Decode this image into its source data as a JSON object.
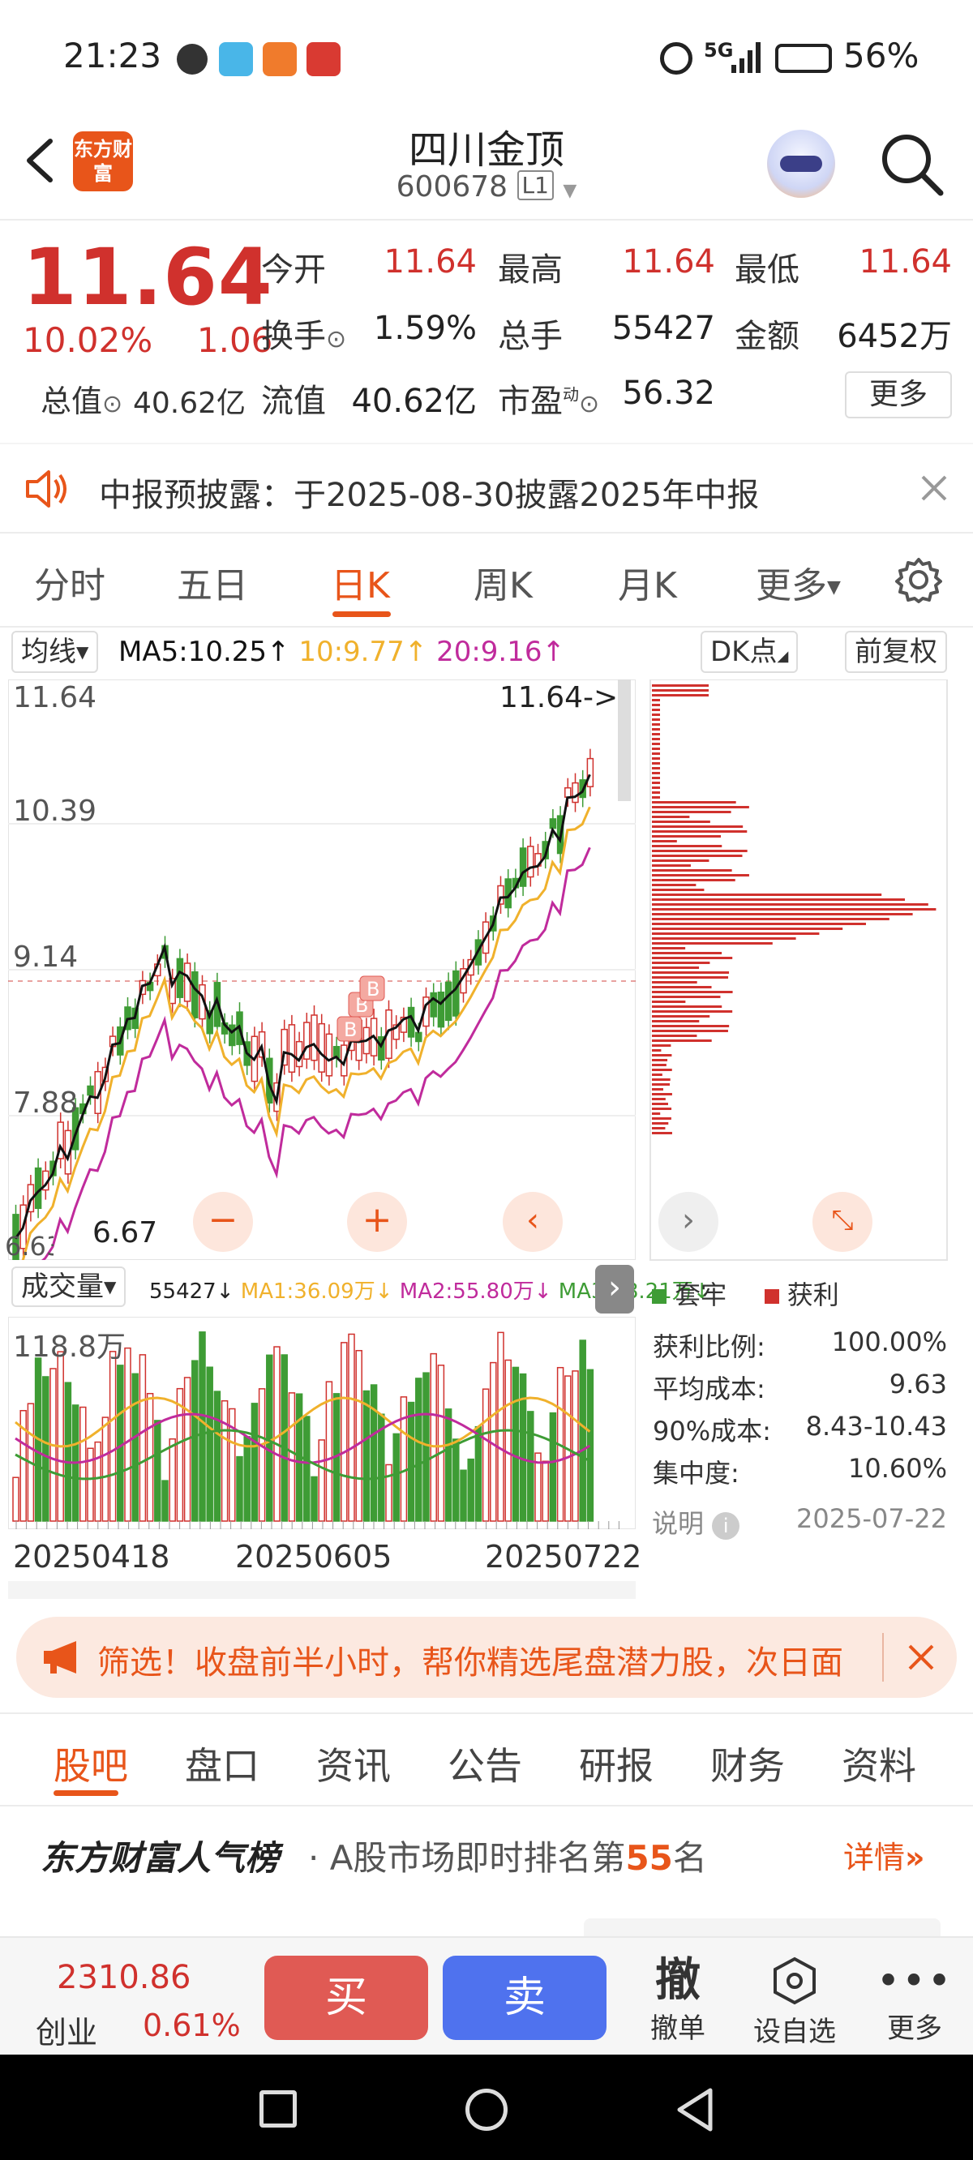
{
  "status_bar": {
    "time": "21:23",
    "network": "5G",
    "battery": "56%"
  },
  "header": {
    "title": "四川金顶",
    "code": "600678",
    "level_badge": "L1",
    "logo_text": "东方财富"
  },
  "quote": {
    "price": "11.64",
    "change_pct": "10.02%",
    "change_abs": "1.06",
    "labels": {
      "open": "今开",
      "high": "最高",
      "low": "最低",
      "turnover": "换手",
      "volume": "总手",
      "amount": "金额",
      "mktcap": "总值",
      "float_cap": "流值",
      "pe": "市盈",
      "pe_sup": "动"
    },
    "values": {
      "open": "11.64",
      "high": "11.64",
      "low": "11.64",
      "turnover": "1.59%",
      "volume": "55427",
      "amount": "6452万",
      "mktcap": "40.62亿",
      "float_cap": "40.62亿",
      "pe": "56.32"
    },
    "more_label": "更多"
  },
  "notice": {
    "text": "中报预披露：于2025-08-30披露2025年中报"
  },
  "period_tabs": [
    "分时",
    "五日",
    "日K",
    "周K",
    "月K",
    "更多"
  ],
  "indicator_row": {
    "ma_selector": "均线",
    "ma5": "MA5:10.25↑",
    "ma10": "10:9.77↑",
    "ma20": "20:9.16↑",
    "dk_button": "DK点",
    "adjust_button": "前复权"
  },
  "kline": {
    "price_labels": [
      "11.64",
      "10.39",
      "9.14",
      "7.88",
      "6.63"
    ],
    "latest_tag": "11.64->",
    "low_tag": "6.67",
    "signal_badges": [
      "B",
      "B",
      "B"
    ]
  },
  "volume_row": {
    "selector": "成交量",
    "vol": "55427↓",
    "ma1": "MA1:36.09万↓",
    "ma2": "MA2:55.80万↓",
    "ma3": "MA3:48.21万↓",
    "max_label": "118.8万",
    "dates": [
      "20250418",
      "20250605",
      "20250722"
    ]
  },
  "chip": {
    "legend_trapped": "套牢",
    "legend_profit": "获利",
    "rows": [
      {
        "label": "获利比例:",
        "value": "100.00%"
      },
      {
        "label": "平均成本:",
        "value": "9.63"
      },
      {
        "label": "90%成本:",
        "value": "8.43-10.43"
      },
      {
        "label": "集中度:",
        "value": "10.60%"
      }
    ],
    "note_label": "说明",
    "date": "2025-07-22"
  },
  "banner": {
    "text": "筛选！收盘前半小时，帮你精选尾盘潜力股，次日面"
  },
  "bottom_tabs": [
    "股吧",
    "盘口",
    "资讯",
    "公告",
    "研报",
    "财务",
    "资料"
  ],
  "popularity": {
    "title": "东方财富人气榜",
    "text_prefix": "· A股市场即时排名第",
    "rank": "55",
    "text_suffix": "名",
    "detail": "详情"
  },
  "trade_bar": {
    "index_value": "2310.86",
    "index_name": "创业",
    "index_change": "0.61%",
    "buy": "买",
    "sell": "卖",
    "cancel_icon": "撤",
    "cancel": "撤单",
    "watchlist": "设自选",
    "more": "更多"
  },
  "colors": {
    "up": "#d0312d",
    "down": "#3e9c35",
    "accent": "#e8551a",
    "ma5": "#111111",
    "ma10": "#f0b12c",
    "ma20": "#c02b9c"
  }
}
